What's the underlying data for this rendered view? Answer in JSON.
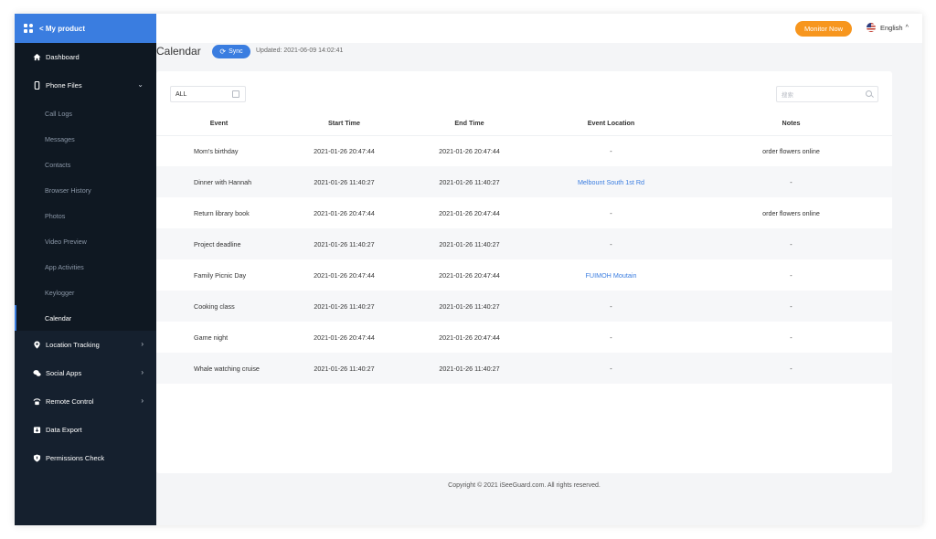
{
  "sidebar": {
    "brand": "< My product",
    "items": [
      {
        "label": "Dashboard"
      },
      {
        "label": "Phone Files"
      },
      {
        "label": "Location Tracking"
      },
      {
        "label": "Social Apps"
      },
      {
        "label": "Remote Control"
      },
      {
        "label": "Data Export"
      },
      {
        "label": "Permissions Check"
      }
    ],
    "phone_files_sub": [
      "Call Logs",
      "Messages",
      "Contacts",
      "Browser History",
      "Photos",
      "Video Preview",
      "App Activities",
      "Keylogger",
      "Calendar"
    ]
  },
  "header": {
    "monitor_button": "Monitor Now",
    "language": "English"
  },
  "page": {
    "title": "Calendar",
    "sync_label": "Sync",
    "updated": "Updated: 2021-06-09 14:02:41"
  },
  "filters": {
    "type_value": "ALL",
    "search_placeholder": "搜索"
  },
  "table": {
    "headers": [
      "Event",
      "Start Time",
      "End Time",
      "Event Location",
      "Notes"
    ],
    "rows": [
      {
        "event": "Mom's birthday",
        "start": "2021-01-26 20:47:44",
        "end": "2021-01-26 20:47:44",
        "location": "-",
        "notes": "order flowers online"
      },
      {
        "event": "Dinner with Hannah",
        "start": "2021-01-26 11:40:27",
        "end": "2021-01-26 11:40:27",
        "location": "Melbount South 1st Rd",
        "notes": "-"
      },
      {
        "event": "Return library book",
        "start": "2021-01-26 20:47:44",
        "end": "2021-01-26 20:47:44",
        "location": "-",
        "notes": "order flowers online"
      },
      {
        "event": "Project deadline",
        "start": "2021-01-26 11:40:27",
        "end": "2021-01-26 11:40:27",
        "location": "-",
        "notes": "-"
      },
      {
        "event": "Family Picnic Day",
        "start": "2021-01-26 20:47:44",
        "end": "2021-01-26 20:47:44",
        "location": "FUIMOH Moutain",
        "notes": "-"
      },
      {
        "event": "Cooking class",
        "start": "2021-01-26 11:40:27",
        "end": "2021-01-26 11:40:27",
        "location": "-",
        "notes": "-"
      },
      {
        "event": "Game night",
        "start": "2021-01-26 20:47:44",
        "end": "2021-01-26 20:47:44",
        "location": "-",
        "notes": "-"
      },
      {
        "event": "Whale watching cruise",
        "start": "2021-01-26 11:40:27",
        "end": "2021-01-26 11:40:27",
        "location": "-",
        "notes": "-"
      }
    ]
  },
  "footer": {
    "copyright": "Copyright © 2021 iSeeGuard.com. All rights reserved."
  },
  "colors": {
    "accent": "#3a7de0",
    "sidebar_bg": "#15202e",
    "monitor_button": "#f7961e"
  }
}
